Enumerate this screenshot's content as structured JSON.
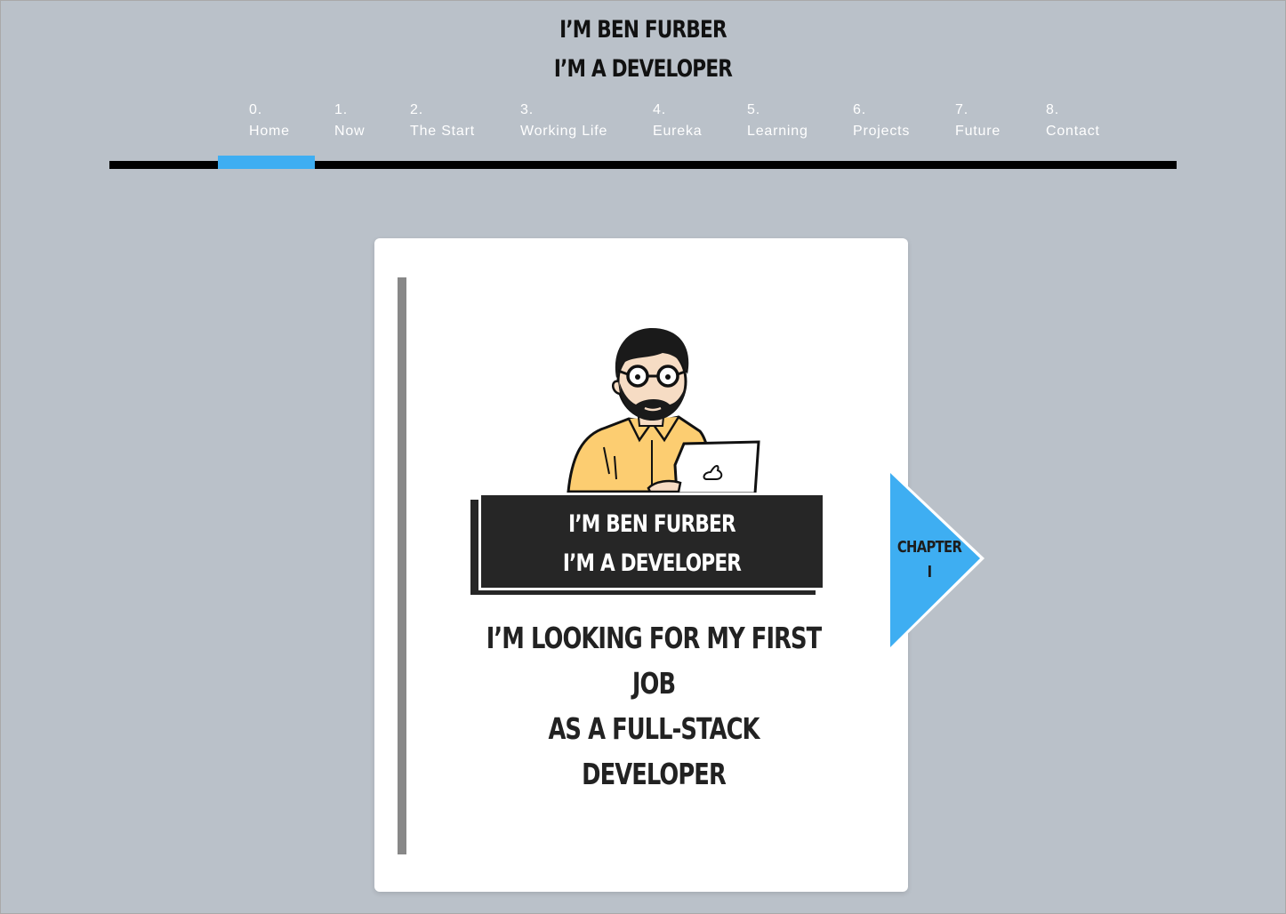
{
  "header": {
    "title_line1": "I’M BEN FURBER",
    "title_line2": "I’M A DEVELOPER"
  },
  "nav": {
    "active_index": 0,
    "active_color": "#3eaef2",
    "items": [
      {
        "number": "0.",
        "label": "Home"
      },
      {
        "number": "1.",
        "label": "Now"
      },
      {
        "number": "2.",
        "label": "The Start"
      },
      {
        "number": "3.",
        "label": "Working Life"
      },
      {
        "number": "4.",
        "label": "Eureka"
      },
      {
        "number": "5.",
        "label": "Learning"
      },
      {
        "number": "6.",
        "label": "Projects"
      },
      {
        "number": "7.",
        "label": "Future"
      },
      {
        "number": "8.",
        "label": "Contact"
      }
    ]
  },
  "card": {
    "banner_line1": "I’M BEN FURBER",
    "banner_line2": "I’M A DEVELOPER",
    "tagline_line1": "I’M LOOKING FOR MY FIRST JOB",
    "tagline_line2": "AS A FULL-STACK DEVELOPER",
    "avatar_icon": "developer-avatar-illustration"
  },
  "chapter": {
    "label": "CHAPTER",
    "numeral": "I",
    "color": "#3eaef2",
    "icon": "arrow-right-icon"
  }
}
